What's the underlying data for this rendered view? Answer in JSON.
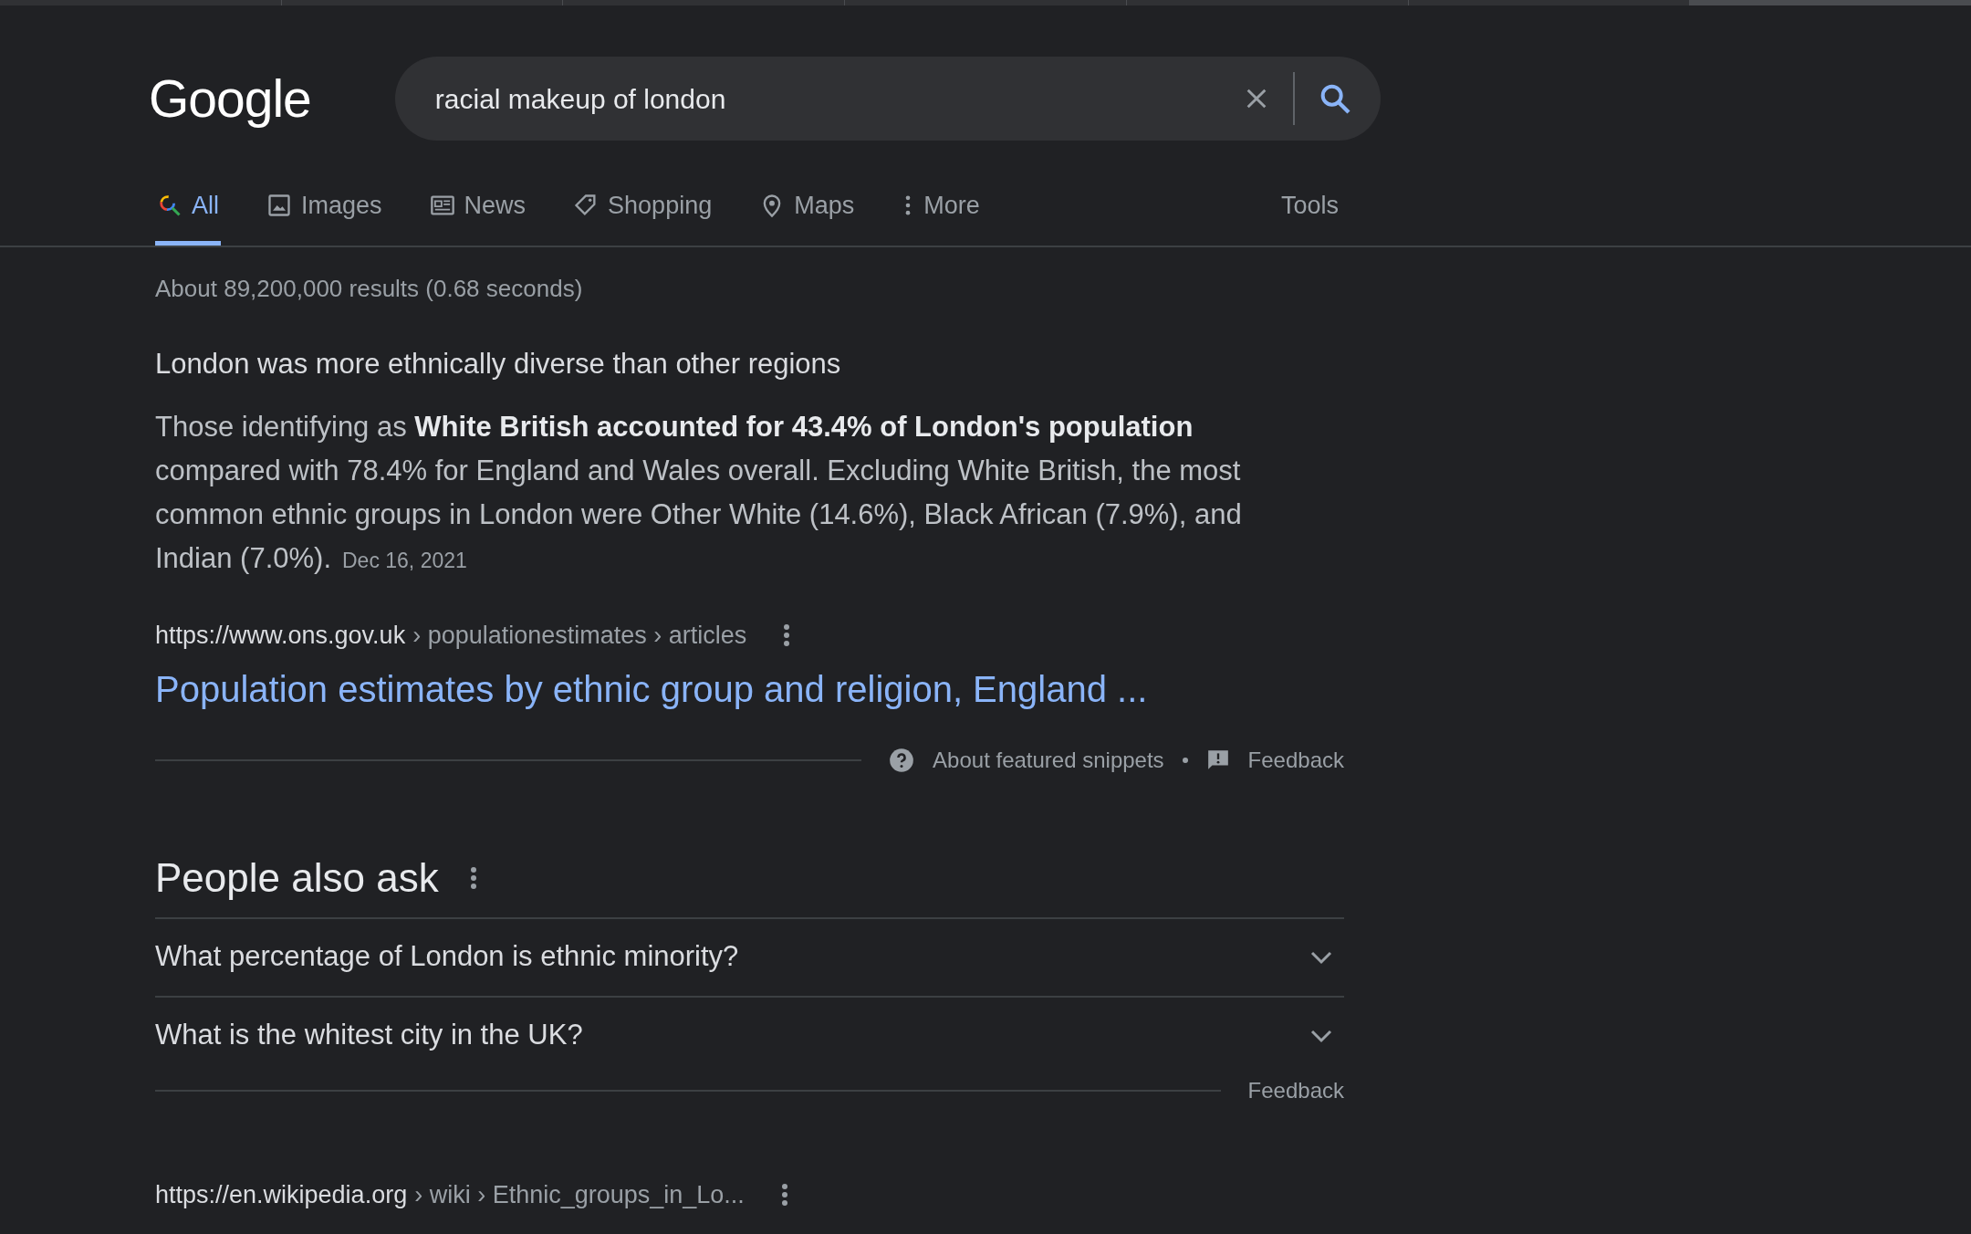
{
  "logo": "Google",
  "search": {
    "query": "racial makeup of london"
  },
  "tabs": [
    {
      "label": "All",
      "selected": true
    },
    {
      "label": "Images",
      "selected": false
    },
    {
      "label": "News",
      "selected": false
    },
    {
      "label": "Shopping",
      "selected": false
    },
    {
      "label": "Maps",
      "selected": false
    },
    {
      "label": "More",
      "selected": false
    }
  ],
  "tools": "Tools",
  "result_stats": "About 89,200,000 results (0.68 seconds)",
  "featured_snippet": {
    "heading": "London was more ethnically diverse than other regions",
    "body": "Those identifying as **White British accounted for 43.4% of London's population** compared with 78.4% for England and Wales overall. Excluding White British, the most common ethnic groups in London were Other White (14.6%), Black African (7.9%), and Indian (7.0%).",
    "date": "Dec 16, 2021",
    "site": "https://www.ons.gov.uk",
    "path": "› populationestimates › articles",
    "title": "Population estimates by ethnic group and religion, England ...",
    "about": "About featured snippets",
    "feedback": "Feedback"
  },
  "people_also_ask": {
    "heading": "People also ask",
    "questions": [
      {
        "text": "What percentage of London is ethnic minority?",
        "expanded": false
      },
      {
        "text": "What is the whitest city in the UK?",
        "expanded": false
      }
    ],
    "feedback": "Feedback"
  },
  "next_result": {
    "site": "https://en.wikipedia.org",
    "path": "› wiki › Ethnic_groups_in_Lo..."
  }
}
